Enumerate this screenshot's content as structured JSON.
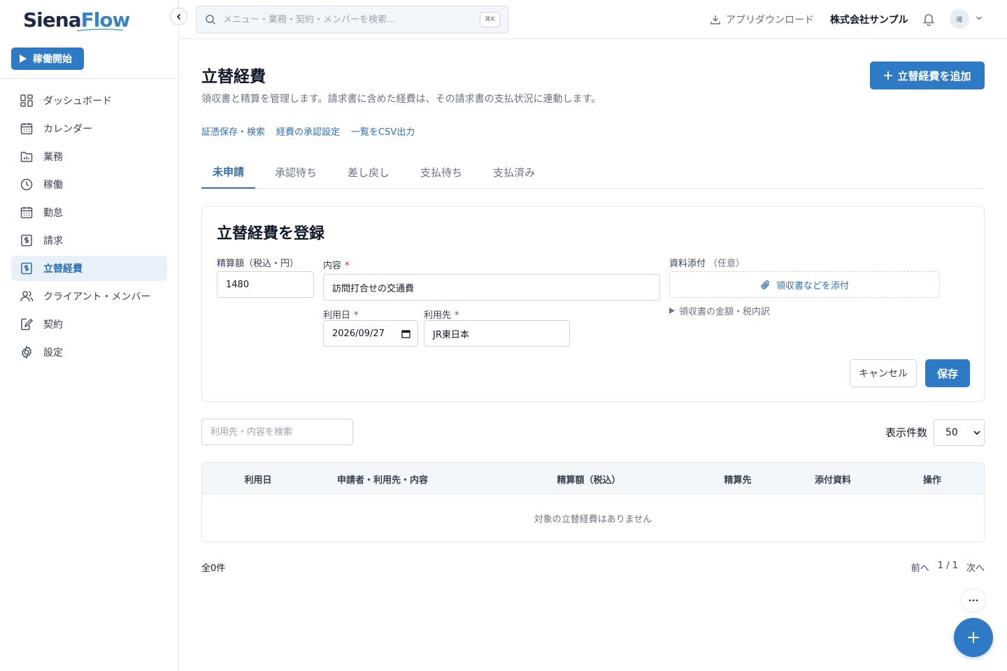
{
  "brand": {
    "part1": "Siena",
    "part2": "Flow"
  },
  "sidebar": {
    "start_label": "稼働開始",
    "items": [
      {
        "label": "ダッシュボード",
        "icon": "dashboard-icon"
      },
      {
        "label": "カレンダー",
        "icon": "calendar-icon"
      },
      {
        "label": "業務",
        "icon": "folder-icon"
      },
      {
        "label": "稼働",
        "icon": "clock-icon"
      },
      {
        "label": "勤怠",
        "icon": "calendar-icon"
      },
      {
        "label": "請求",
        "icon": "invoice-icon"
      },
      {
        "label": "立替経費",
        "icon": "expense-icon",
        "active": true
      },
      {
        "label": "クライアント・メンバー",
        "icon": "users-icon"
      },
      {
        "label": "契約",
        "icon": "contract-icon"
      },
      {
        "label": "設定",
        "icon": "gear-icon"
      }
    ]
  },
  "header": {
    "search_placeholder": "メニュー・業務・契約・メンバーを検索...",
    "search_shortcut": "⌘K",
    "app_download": "アプリダウンロード",
    "company": "株式会社サンプル",
    "avatar_text": "確"
  },
  "page": {
    "title": "立替経費",
    "description": "領収書と精算を管理します。請求書に含めた経費は、その請求書の支払状況に連動します。",
    "add_button": "立替経費を追加",
    "links": [
      "証憑保存・検索",
      "経費の承認設定",
      "一覧をCSV出力"
    ],
    "tabs": [
      {
        "label": "未申請",
        "active": true
      },
      {
        "label": "承認待ち"
      },
      {
        "label": "差し戻し"
      },
      {
        "label": "支払待ち"
      },
      {
        "label": "支払済み"
      }
    ]
  },
  "form": {
    "title": "立替経費を登録",
    "amount_label": "精算額（税込・円）",
    "amount_value": "1480",
    "content_label": "内容",
    "content_value": "訪問打合せの交通費",
    "date_label": "利用日",
    "date_value": "2026/09/27",
    "vendor_label": "利用先",
    "vendor_value": "JR東日本",
    "required_mark": "*",
    "attach_label": "資料添付",
    "attach_optional": "（任意）",
    "attach_button": "領収書などを添付",
    "receipt_toggle": "領収書の金額・税内訳",
    "cancel": "キャンセル",
    "save": "保存"
  },
  "list": {
    "search_placeholder": "利用先・内容を検索",
    "per_page_label": "表示件数",
    "per_page_value": "50",
    "columns": [
      "利用日",
      "申請者・利用先・内容",
      "精算額（税込）",
      "精算先",
      "添付資料",
      "操作"
    ],
    "empty": "対象の立替経費はありません",
    "total": "全0件",
    "prev": "前へ",
    "page_info": "1 / 1",
    "next": "次へ"
  },
  "colors": {
    "accent": "#2f7ac4",
    "brand_dark": "#1e2a4a",
    "brand_light": "#3b82c4"
  }
}
